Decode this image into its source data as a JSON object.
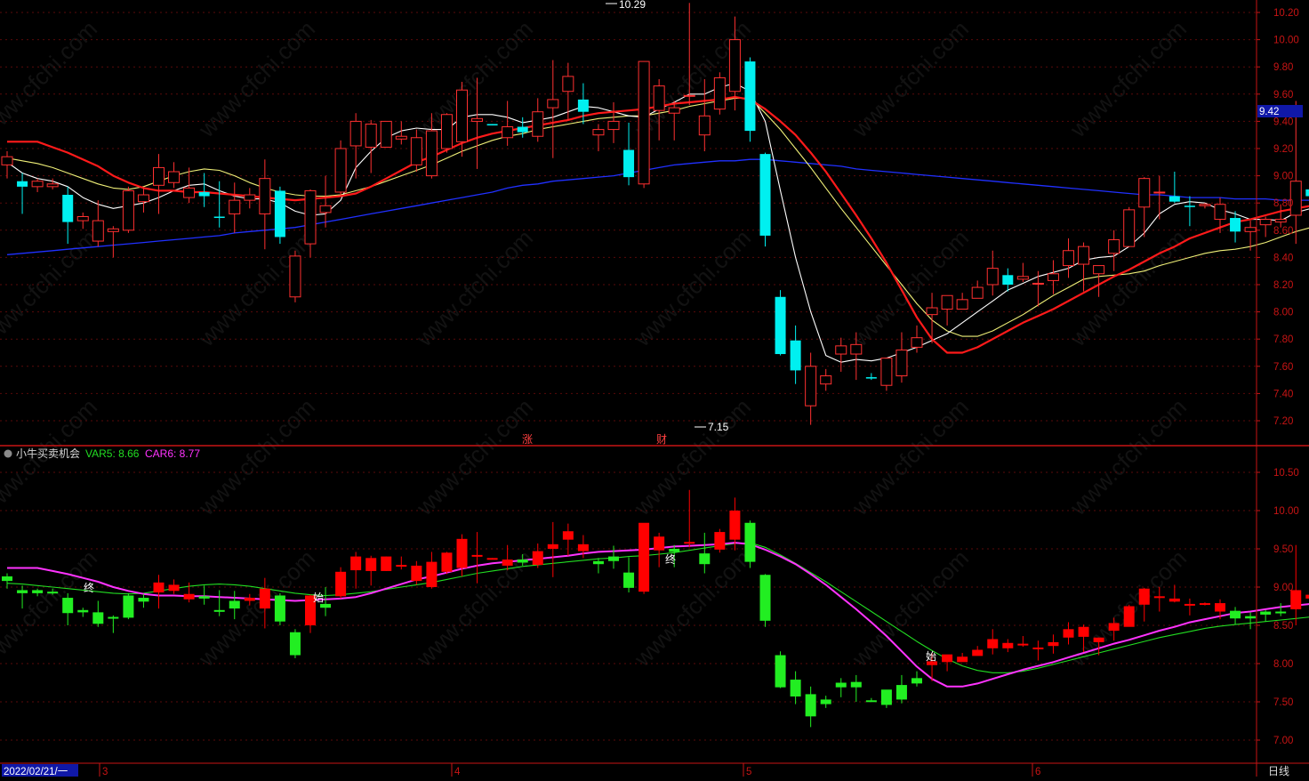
{
  "indicator": {
    "name": "小牛买卖机会",
    "var5_label": "VAR5: 8.66",
    "car6_label": "CAR6: 8.77"
  },
  "markers": {
    "high_label": "10.29",
    "low_label": "7.15",
    "current_price": "9.42",
    "tag_zhang": "涨",
    "tag_cai": "财",
    "sig_end": "终",
    "sig_start": "始"
  },
  "xaxis": {
    "date_label": "2022/02/21/一",
    "months": [
      "3",
      "4",
      "5",
      "6"
    ],
    "period": "日线"
  },
  "watermark": "www.cfchi.com",
  "colors": {
    "up": "#ff3030",
    "down": "#00f0f0",
    "ind_up": "#ff0000",
    "ind_down": "#22ee22",
    "ma_white": "#ffffff",
    "ma_yellow": "#f0f078",
    "ma_red": "#ff1a1a",
    "ma_blue": "#2030ff",
    "car6": "#ff33ff",
    "var5": "#22dd22",
    "axis_red": "#c81414"
  },
  "chart_data": [
    {
      "type": "candlestick",
      "title": "",
      "ylim": [
        7.05,
        10.32
      ],
      "y_ticks": [
        7.2,
        7.4,
        7.6,
        7.8,
        8.0,
        8.2,
        8.4,
        8.6,
        8.8,
        9.0,
        9.2,
        9.4,
        9.6,
        9.8,
        10.0,
        10.2
      ],
      "ohlc": [
        [
          9.08,
          9.18,
          8.98,
          9.14
        ],
        [
          8.96,
          9.02,
          8.72,
          8.92
        ],
        [
          8.92,
          8.98,
          8.88,
          8.96
        ],
        [
          8.92,
          8.98,
          8.9,
          8.94
        ],
        [
          8.86,
          8.92,
          8.5,
          8.66
        ],
        [
          8.67,
          8.73,
          8.61,
          8.7
        ],
        [
          8.52,
          8.82,
          8.48,
          8.67
        ],
        [
          8.59,
          8.63,
          8.4,
          8.61
        ],
        [
          8.6,
          8.92,
          8.58,
          8.89
        ],
        [
          8.81,
          8.91,
          8.73,
          8.86
        ],
        [
          8.93,
          9.16,
          8.72,
          9.06
        ],
        [
          8.95,
          9.1,
          8.91,
          9.03
        ],
        [
          8.84,
          9.06,
          8.8,
          8.91
        ],
        [
          8.88,
          9.02,
          8.77,
          8.85
        ],
        [
          8.7,
          8.96,
          8.62,
          8.69
        ],
        [
          8.72,
          8.95,
          8.58,
          8.82
        ],
        [
          8.82,
          8.91,
          8.76,
          8.86
        ],
        [
          8.72,
          9.12,
          8.46,
          8.98
        ],
        [
          8.89,
          8.92,
          8.5,
          8.55
        ],
        [
          8.11,
          8.45,
          8.07,
          8.41
        ],
        [
          8.5,
          8.9,
          8.4,
          8.89
        ],
        [
          8.73,
          9.0,
          8.62,
          8.78
        ],
        [
          8.88,
          9.26,
          8.85,
          9.2
        ],
        [
          9.22,
          9.46,
          8.98,
          9.4
        ],
        [
          9.21,
          9.41,
          9.02,
          9.38
        ],
        [
          9.21,
          9.4,
          9.21,
          9.4
        ],
        [
          9.27,
          9.4,
          9.23,
          9.29
        ],
        [
          9.08,
          9.34,
          9.03,
          9.28
        ],
        [
          9.0,
          9.46,
          8.98,
          9.33
        ],
        [
          9.2,
          9.46,
          9.17,
          9.45
        ],
        [
          9.25,
          9.69,
          9.14,
          9.63
        ],
        [
          9.4,
          9.72,
          9.05,
          9.42
        ],
        [
          9.38,
          9.38,
          9.37,
          9.37
        ],
        [
          9.28,
          9.55,
          9.22,
          9.36
        ],
        [
          9.36,
          9.43,
          9.28,
          9.32
        ],
        [
          9.29,
          9.57,
          9.25,
          9.47
        ],
        [
          9.5,
          9.85,
          9.13,
          9.56
        ],
        [
          9.62,
          9.83,
          9.41,
          9.73
        ],
        [
          9.56,
          9.68,
          9.38,
          9.47
        ],
        [
          9.3,
          9.38,
          9.18,
          9.34
        ],
        [
          9.34,
          9.54,
          9.24,
          9.4
        ],
        [
          9.19,
          9.39,
          8.93,
          8.99
        ],
        [
          8.94,
          9.62,
          8.91,
          9.84
        ],
        [
          9.48,
          9.71,
          9.26,
          9.66
        ],
        [
          9.46,
          9.55,
          9.26,
          9.5
        ],
        [
          9.59,
          10.27,
          9.52,
          9.59
        ],
        [
          9.3,
          9.71,
          9.18,
          9.44
        ],
        [
          9.49,
          9.76,
          9.45,
          9.72
        ],
        [
          9.62,
          10.17,
          9.48,
          10.0
        ],
        [
          9.84,
          9.87,
          9.25,
          9.33
        ],
        [
          9.16,
          9.17,
          8.48,
          8.56
        ],
        [
          8.11,
          8.16,
          7.68,
          7.69
        ],
        [
          7.79,
          7.9,
          7.47,
          7.57
        ],
        [
          7.31,
          7.7,
          7.17,
          7.6
        ],
        [
          7.47,
          7.58,
          7.42,
          7.53
        ],
        [
          7.69,
          7.81,
          7.56,
          7.75
        ],
        [
          7.69,
          7.85,
          7.5,
          7.76
        ],
        [
          7.52,
          7.55,
          7.5,
          7.51
        ],
        [
          7.46,
          7.64,
          7.42,
          7.66
        ],
        [
          7.53,
          7.85,
          7.48,
          7.72
        ],
        [
          7.74,
          7.9,
          7.7,
          7.81
        ],
        [
          7.98,
          8.14,
          7.77,
          8.03
        ],
        [
          8.02,
          8.04,
          7.9,
          8.12
        ],
        [
          8.02,
          8.14,
          8.07,
          8.09
        ],
        [
          8.1,
          8.23,
          8.14,
          8.18
        ],
        [
          8.2,
          8.45,
          8.12,
          8.32
        ],
        [
          8.27,
          8.32,
          8.15,
          8.2
        ],
        [
          8.24,
          8.36,
          8.22,
          8.26
        ],
        [
          8.21,
          8.3,
          8.04,
          8.21
        ],
        [
          8.23,
          8.38,
          8.13,
          8.28
        ],
        [
          8.34,
          8.54,
          8.25,
          8.45
        ],
        [
          8.35,
          8.51,
          8.15,
          8.48
        ],
        [
          8.28,
          8.34,
          8.11,
          8.34
        ],
        [
          8.43,
          8.6,
          8.3,
          8.53
        ],
        [
          8.48,
          8.77,
          8.5,
          8.75
        ],
        [
          8.77,
          8.99,
          8.55,
          8.98
        ],
        [
          8.88,
          9.0,
          8.68,
          8.88
        ],
        [
          8.85,
          9.03,
          8.8,
          8.81
        ],
        [
          8.78,
          8.85,
          8.63,
          8.77
        ],
        [
          8.78,
          8.8,
          8.76,
          8.79
        ],
        [
          8.68,
          8.84,
          8.58,
          8.79
        ],
        [
          8.69,
          8.74,
          8.51,
          8.59
        ],
        [
          8.59,
          8.67,
          8.45,
          8.62
        ],
        [
          8.64,
          8.7,
          8.55,
          8.68
        ],
        [
          8.66,
          8.79,
          8.62,
          8.68
        ],
        [
          8.71,
          9.55,
          8.5,
          8.96
        ],
        [
          8.9,
          8.93,
          8.73,
          8.85
        ],
        [
          8.78,
          8.99,
          8.59,
          8.99
        ],
        [
          8.78,
          9.18,
          8.66,
          9.02
        ],
        [
          8.88,
          8.91,
          8.75,
          8.94
        ]
      ],
      "ma_white": [
        9.1,
        9.02,
        8.98,
        8.96,
        8.92,
        8.84,
        8.79,
        8.76,
        8.78,
        8.8,
        8.84,
        8.89,
        8.93,
        8.94,
        8.89,
        8.85,
        8.83,
        8.83,
        8.8,
        8.74,
        8.71,
        8.72,
        8.82,
        9.06,
        9.18,
        9.28,
        9.33,
        9.35,
        9.34,
        9.34,
        9.43,
        9.45,
        9.45,
        9.43,
        9.39,
        9.41,
        9.43,
        9.47,
        9.51,
        9.5,
        9.47,
        9.44,
        9.43,
        9.49,
        9.54,
        9.6,
        9.6,
        9.65,
        9.68,
        9.62,
        9.4,
        8.89,
        8.4,
        8.0,
        7.68,
        7.63,
        7.65,
        7.64,
        7.66,
        7.7,
        7.74,
        7.79,
        7.84,
        7.92,
        8.0,
        8.08,
        8.16,
        8.21,
        8.26,
        8.29,
        8.32,
        8.38,
        8.4,
        8.41,
        8.48,
        8.58,
        8.72,
        8.79,
        8.81,
        8.8,
        8.75,
        8.72,
        8.68,
        8.68,
        8.67,
        8.73,
        8.76,
        8.8,
        8.86,
        8.88
      ],
      "ma_yellow": [
        9.13,
        9.11,
        9.09,
        9.06,
        9.02,
        8.98,
        8.94,
        8.91,
        8.9,
        8.92,
        8.96,
        9.0,
        9.03,
        9.05,
        9.04,
        9.0,
        8.95,
        8.91,
        8.88,
        8.86,
        8.85,
        8.85,
        8.86,
        8.89,
        8.92,
        8.96,
        9.0,
        9.04,
        9.08,
        9.13,
        9.18,
        9.22,
        9.26,
        9.29,
        9.31,
        9.34,
        9.36,
        9.38,
        9.4,
        9.42,
        9.43,
        9.44,
        9.44,
        9.46,
        9.48,
        9.51,
        9.53,
        9.55,
        9.57,
        9.57,
        9.46,
        9.34,
        9.2,
        9.06,
        8.91,
        8.76,
        8.62,
        8.48,
        8.34,
        8.2,
        8.06,
        7.94,
        7.86,
        7.82,
        7.82,
        7.86,
        7.92,
        7.98,
        8.05,
        8.12,
        8.18,
        8.24,
        8.26,
        8.27,
        8.28,
        8.3,
        8.34,
        8.37,
        8.4,
        8.43,
        8.45,
        8.46,
        8.48,
        8.51,
        8.55,
        8.59,
        8.62,
        8.65,
        8.68,
        8.71
      ],
      "ma_red": [
        9.25,
        9.25,
        9.25,
        9.21,
        9.17,
        9.12,
        9.07,
        9.0,
        8.95,
        8.91,
        8.89,
        8.89,
        8.88,
        8.88,
        8.87,
        8.86,
        8.85,
        8.84,
        8.83,
        8.82,
        8.83,
        8.84,
        8.85,
        8.87,
        8.92,
        8.98,
        9.04,
        9.1,
        9.14,
        9.19,
        9.24,
        9.28,
        9.31,
        9.33,
        9.35,
        9.37,
        9.39,
        9.41,
        9.44,
        9.46,
        9.47,
        9.48,
        9.49,
        9.51,
        9.53,
        9.54,
        9.55,
        9.56,
        9.58,
        9.56,
        9.49,
        9.4,
        9.3,
        9.17,
        9.03,
        8.87,
        8.71,
        8.54,
        8.36,
        8.16,
        7.96,
        7.8,
        7.7,
        7.7,
        7.74,
        7.8,
        7.86,
        7.92,
        7.97,
        8.02,
        8.08,
        8.14,
        8.2,
        8.26,
        8.31,
        8.37,
        8.43,
        8.48,
        8.54,
        8.58,
        8.62,
        8.66,
        8.68,
        8.71,
        8.74,
        8.76,
        8.78,
        8.79,
        8.8,
        8.8
      ],
      "ma_blue": [
        8.42,
        8.43,
        8.44,
        8.45,
        8.46,
        8.47,
        8.48,
        8.49,
        8.5,
        8.51,
        8.52,
        8.53,
        8.54,
        8.55,
        8.56,
        8.58,
        8.59,
        8.6,
        8.61,
        8.62,
        8.64,
        8.66,
        8.68,
        8.7,
        8.72,
        8.74,
        8.76,
        8.78,
        8.8,
        8.82,
        8.84,
        8.86,
        8.88,
        8.91,
        8.93,
        8.94,
        8.96,
        8.97,
        8.98,
        8.99,
        9.0,
        9.02,
        9.04,
        9.06,
        9.08,
        9.09,
        9.1,
        9.11,
        9.11,
        9.12,
        9.12,
        9.11,
        9.1,
        9.09,
        9.08,
        9.07,
        9.05,
        9.04,
        9.03,
        9.02,
        9.01,
        9.0,
        8.99,
        8.98,
        8.97,
        8.96,
        8.95,
        8.94,
        8.93,
        8.92,
        8.91,
        8.9,
        8.89,
        8.88,
        8.87,
        8.86,
        8.86,
        8.85,
        8.84,
        8.84,
        8.84,
        8.83,
        8.83,
        8.83,
        8.82,
        8.82,
        8.82,
        8.81,
        8.81,
        8.81
      ]
    },
    {
      "type": "candlestick",
      "title": "",
      "ylim": [
        6.85,
        10.9
      ],
      "y_ticks": [
        7.0,
        7.5,
        8.0,
        8.5,
        9.0,
        9.5,
        10.0,
        10.5
      ],
      "car6": [
        9.25,
        9.25,
        9.25,
        9.21,
        9.17,
        9.12,
        9.07,
        9.0,
        8.95,
        8.91,
        8.89,
        8.89,
        8.88,
        8.88,
        8.87,
        8.86,
        8.85,
        8.84,
        8.83,
        8.82,
        8.83,
        8.84,
        8.85,
        8.87,
        8.92,
        8.98,
        9.04,
        9.1,
        9.14,
        9.19,
        9.24,
        9.28,
        9.31,
        9.33,
        9.35,
        9.37,
        9.39,
        9.41,
        9.44,
        9.46,
        9.47,
        9.48,
        9.49,
        9.51,
        9.53,
        9.54,
        9.55,
        9.56,
        9.58,
        9.56,
        9.49,
        9.4,
        9.3,
        9.17,
        9.03,
        8.87,
        8.71,
        8.54,
        8.36,
        8.16,
        7.96,
        7.8,
        7.7,
        7.7,
        7.74,
        7.8,
        7.86,
        7.92,
        7.97,
        8.02,
        8.08,
        8.14,
        8.2,
        8.26,
        8.31,
        8.37,
        8.43,
        8.48,
        8.54,
        8.58,
        8.62,
        8.66,
        8.68,
        8.71,
        8.74,
        8.76,
        8.78,
        8.79,
        8.8,
        8.8
      ],
      "var5": [
        9.05,
        9.04,
        9.02,
        9.0,
        8.98,
        8.96,
        8.94,
        8.92,
        8.91,
        8.92,
        8.95,
        8.98,
        9.01,
        9.03,
        9.04,
        9.03,
        9.01,
        8.98,
        8.95,
        8.92,
        8.9,
        8.89,
        8.9,
        8.92,
        8.94,
        8.97,
        9.0,
        9.03,
        9.06,
        9.1,
        9.14,
        9.18,
        9.21,
        9.24,
        9.27,
        9.29,
        9.31,
        9.33,
        9.35,
        9.37,
        9.38,
        9.4,
        9.41,
        9.43,
        9.45,
        9.48,
        9.51,
        9.54,
        9.57,
        9.58,
        9.52,
        9.42,
        9.31,
        9.19,
        9.07,
        8.94,
        8.81,
        8.68,
        8.55,
        8.42,
        8.29,
        8.17,
        8.06,
        7.97,
        7.91,
        7.88,
        7.88,
        7.9,
        7.94,
        7.99,
        8.04,
        8.09,
        8.14,
        8.19,
        8.24,
        8.29,
        8.34,
        8.38,
        8.42,
        8.46,
        8.49,
        8.51,
        8.53,
        8.55,
        8.57,
        8.59,
        8.61,
        8.63,
        8.65,
        8.66
      ]
    }
  ]
}
